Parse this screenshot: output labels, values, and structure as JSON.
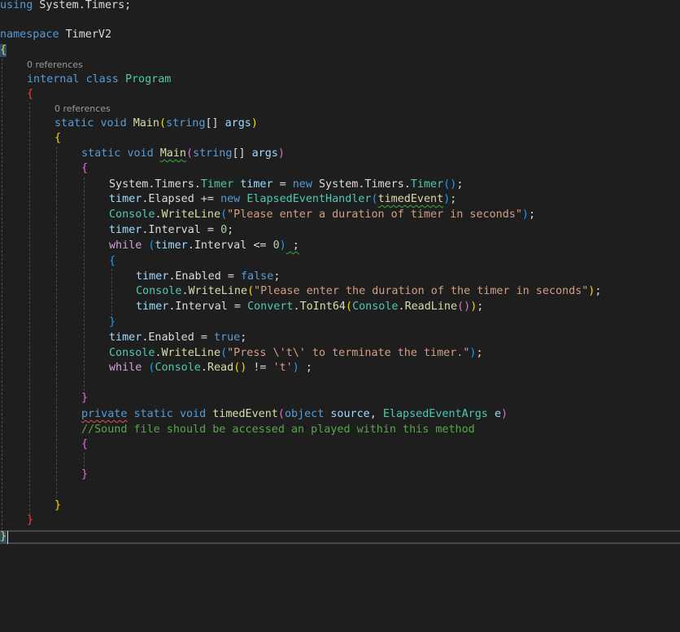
{
  "code": {
    "l1": {
      "kw": "using",
      "rest": " System.Timers;"
    },
    "l2": {
      "kw": "namespace",
      "name": " TimerV2"
    },
    "l3": {
      "brace": "{"
    },
    "ref_class": "0 references",
    "l4": {
      "kw1": "internal",
      "kw2": "class",
      "type": "Program"
    },
    "l5": {
      "brace": "{"
    },
    "ref_main": "0 references",
    "l6": {
      "kw1": "static",
      "kw2": "void",
      "method": "Main",
      "open": "(",
      "kw3": "string",
      "arr": "[]",
      "param": "args",
      "close": ")"
    },
    "l7": {
      "brace": "{"
    },
    "l8": {
      "kw1": "static",
      "kw2": "void",
      "method": "Main",
      "open": "(",
      "kw3": "string",
      "arr": "[]",
      "param": "args",
      "close": ")"
    },
    "l9": {
      "brace": "{"
    },
    "l10": {
      "ns": "System.Timers.",
      "type": "Timer",
      "var": "timer",
      "eq": " = ",
      "kw": "new",
      "ns2": " System.Timers.",
      "type2": "Timer",
      "paren": "()",
      "end": ";"
    },
    "l11": {
      "var": "timer",
      "dot": ".",
      "prop": "Elapsed",
      "op": " += ",
      "kw": "new",
      "type": "ElapsedEventHandler",
      "open": "(",
      "arg": "timedEvent",
      "close": ")",
      "end": ";"
    },
    "l12": {
      "type": "Console",
      "dot": ".",
      "method": "WriteLine",
      "open": "(",
      "str": "\"Please enter a duration of timer in seconds\"",
      "close": ")",
      "end": ";"
    },
    "l13": {
      "var": "timer",
      "dot": ".",
      "prop": "Interval",
      "op": " = ",
      "num": "0",
      "end": ";"
    },
    "l14": {
      "kw": "while",
      "open": " (",
      "var": "timer",
      "dot": ".",
      "prop": "Interval",
      "op": " <= ",
      "num": "0",
      "close": ")",
      "end": " ;"
    },
    "l15": {
      "brace": "{"
    },
    "l16": {
      "var": "timer",
      "dot": ".",
      "prop": "Enabled",
      "op": " = ",
      "kw": "false",
      "end": ";"
    },
    "l17": {
      "type": "Console",
      "dot": ".",
      "method": "WriteLine",
      "open": "(",
      "str": "\"Please enter the duration of the timer in seconds\"",
      "close": ")",
      "end": ";"
    },
    "l18": {
      "var": "timer",
      "dot": ".",
      "prop": "Interval",
      "op": " = ",
      "type": "Convert",
      "dot2": ".",
      "method": "ToInt64",
      "open": "(",
      "type2": "Console",
      "dot3": ".",
      "method2": "ReadLine",
      "paren": "()",
      "close": ")",
      "end": ";"
    },
    "l19": {
      "brace": "}"
    },
    "l20": {
      "var": "timer",
      "dot": ".",
      "prop": "Enabled",
      "op": " = ",
      "kw": "true",
      "end": ";"
    },
    "l21": {
      "type": "Console",
      "dot": ".",
      "method": "WriteLine",
      "open": "(",
      "str": "\"Press \\'t\\' to terminate the timer.\"",
      "close": ")",
      "end": ";"
    },
    "l22": {
      "kw": "while",
      "open": " (",
      "type": "Console",
      "dot": ".",
      "method": "Read",
      "paren": "()",
      "op": " != ",
      "str": "'t'",
      "close": ")",
      "end": " ;"
    },
    "l23": {
      "brace": "}"
    },
    "l24": {
      "kw1": "private",
      "kw2": "static",
      "kw3": "void",
      "method": "timedEvent",
      "open": "(",
      "kw4": "object",
      "p1": "source",
      "comma": ", ",
      "type": "ElapsedEventArgs",
      "p2": "e",
      "close": ")"
    },
    "l25": {
      "comment": "//Sound file should be accessed an played within this method"
    },
    "l26": {
      "brace": "{"
    },
    "l27": {
      "brace": "}"
    },
    "l28": {
      "brace": "}"
    },
    "l29": {
      "brace": "}"
    },
    "l30": {
      "brace": "}"
    }
  }
}
